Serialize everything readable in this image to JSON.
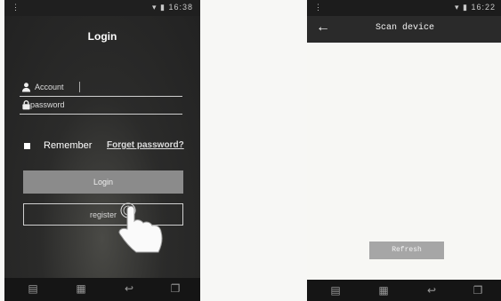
{
  "login_screen": {
    "status_time": "16:38",
    "title": "Login",
    "account_placeholder": "Account",
    "password_placeholder": "password",
    "remember_label": "Remember",
    "forgot_label": "Forget password?",
    "login_button": "Login",
    "register_button": "register"
  },
  "scan_screen": {
    "status_time": "16:22",
    "back_icon": "arrow-left-icon",
    "title": "Scan device",
    "refresh_button": "Refresh"
  }
}
